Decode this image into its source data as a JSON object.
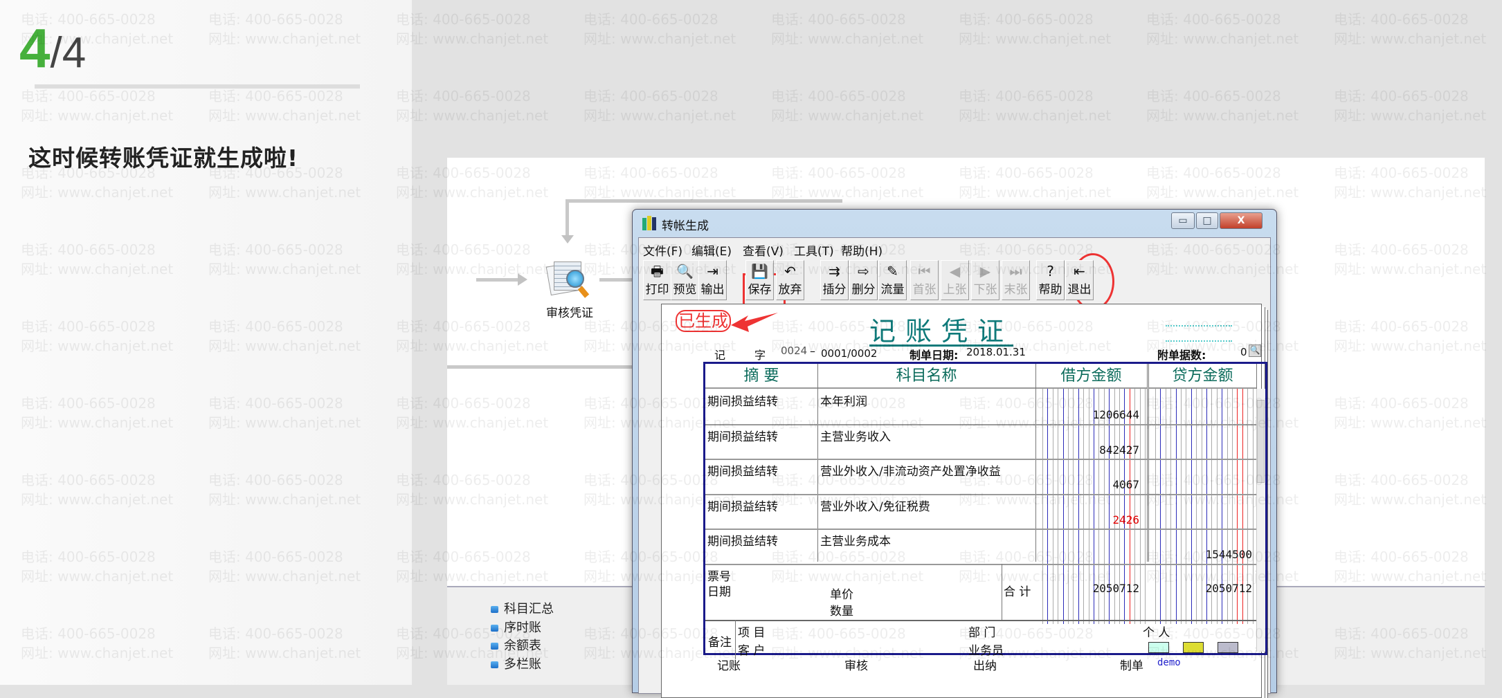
{
  "guide": {
    "step_current": "4",
    "step_total": "/4",
    "headline": "这时候转账凭证就生成啦!"
  },
  "flow": {
    "audit_label": "审核凭证",
    "ledgers": [
      "科目汇总",
      "序时账",
      "余额表",
      "多栏账"
    ]
  },
  "window": {
    "title": "转帐生成",
    "controls": {
      "minimize": "▭",
      "maximize": "□",
      "close": "X"
    }
  },
  "menu": [
    "文件(F)",
    "编辑(E)",
    "查看(V)",
    "工具(T)",
    "帮助(H)"
  ],
  "toolbar": [
    {
      "label": "打印",
      "icon": "🖶",
      "enabled": true
    },
    {
      "label": "预览",
      "icon": "🔍",
      "enabled": true
    },
    {
      "label": "输出",
      "icon": "⇥",
      "enabled": true
    },
    {
      "label": "保存",
      "icon": "💾",
      "enabled": true
    },
    {
      "label": "放弃",
      "icon": "↶",
      "enabled": true
    },
    {
      "label": "插分",
      "icon": "⇉",
      "enabled": true
    },
    {
      "label": "删分",
      "icon": "⇨",
      "enabled": true
    },
    {
      "label": "流量",
      "icon": "✎",
      "enabled": true
    },
    {
      "label": "首张",
      "icon": "⏮",
      "enabled": false
    },
    {
      "label": "上张",
      "icon": "◀",
      "enabled": false
    },
    {
      "label": "下张",
      "icon": "▶",
      "enabled": false
    },
    {
      "label": "末张",
      "icon": "⏭",
      "enabled": false
    },
    {
      "label": "帮助",
      "icon": "?",
      "enabled": true
    },
    {
      "label": "退出",
      "icon": "⇤",
      "enabled": true
    }
  ],
  "voucher": {
    "stamp": "已生成",
    "title": "记账凭证",
    "type_char": "记",
    "zi": "字",
    "number": "0024",
    "sep": "–",
    "page": "0001/0002",
    "date_label": "制单日期:",
    "date": "2018.01.31",
    "attach_label": "附单据数:",
    "attach": "0",
    "headers": [
      "摘 要",
      "科目名称",
      "借方金额",
      "贷方金额"
    ],
    "rows": [
      {
        "summary": "期间损益结转",
        "account": "本年利润",
        "debit": "1206644",
        "credit": "",
        "negative": false
      },
      {
        "summary": "期间损益结转",
        "account": "主营业务收入",
        "debit": "842427",
        "credit": "",
        "negative": false
      },
      {
        "summary": "期间损益结转",
        "account": "营业外收入/非流动资产处置净收益",
        "debit": "4067",
        "credit": "",
        "negative": false
      },
      {
        "summary": "期间损益结转",
        "account": "营业外收入/免征税费",
        "debit": "2426",
        "credit": "",
        "negative": true
      },
      {
        "summary": "期间损益结转",
        "account": "主营业务成本",
        "debit": "",
        "credit": "1544500",
        "negative": false
      }
    ],
    "ticket_label": "票号",
    "date_row_label": "日期",
    "unit_price": "单价",
    "quantity": "数量",
    "total_label": "合 计",
    "total_debit": "2050712",
    "total_credit": "2050712",
    "remark": "备注",
    "project": "项 目",
    "customer": "客 户",
    "dept": "部 门",
    "salesman": "业务员",
    "person": "个 人",
    "sign": {
      "bookkeep": "记账",
      "audit": "审核",
      "cashier": "出纳",
      "maker": "制单",
      "maker_name": "demo"
    }
  },
  "colors": {
    "accent_green": "#46b03c",
    "highlight_red": "#e33333",
    "table_border": "#1a1a8a",
    "negative": "#e00000"
  },
  "watermark": {
    "phone": "电话: 400-665-0028",
    "site": "网址: www.chanjet.net"
  }
}
